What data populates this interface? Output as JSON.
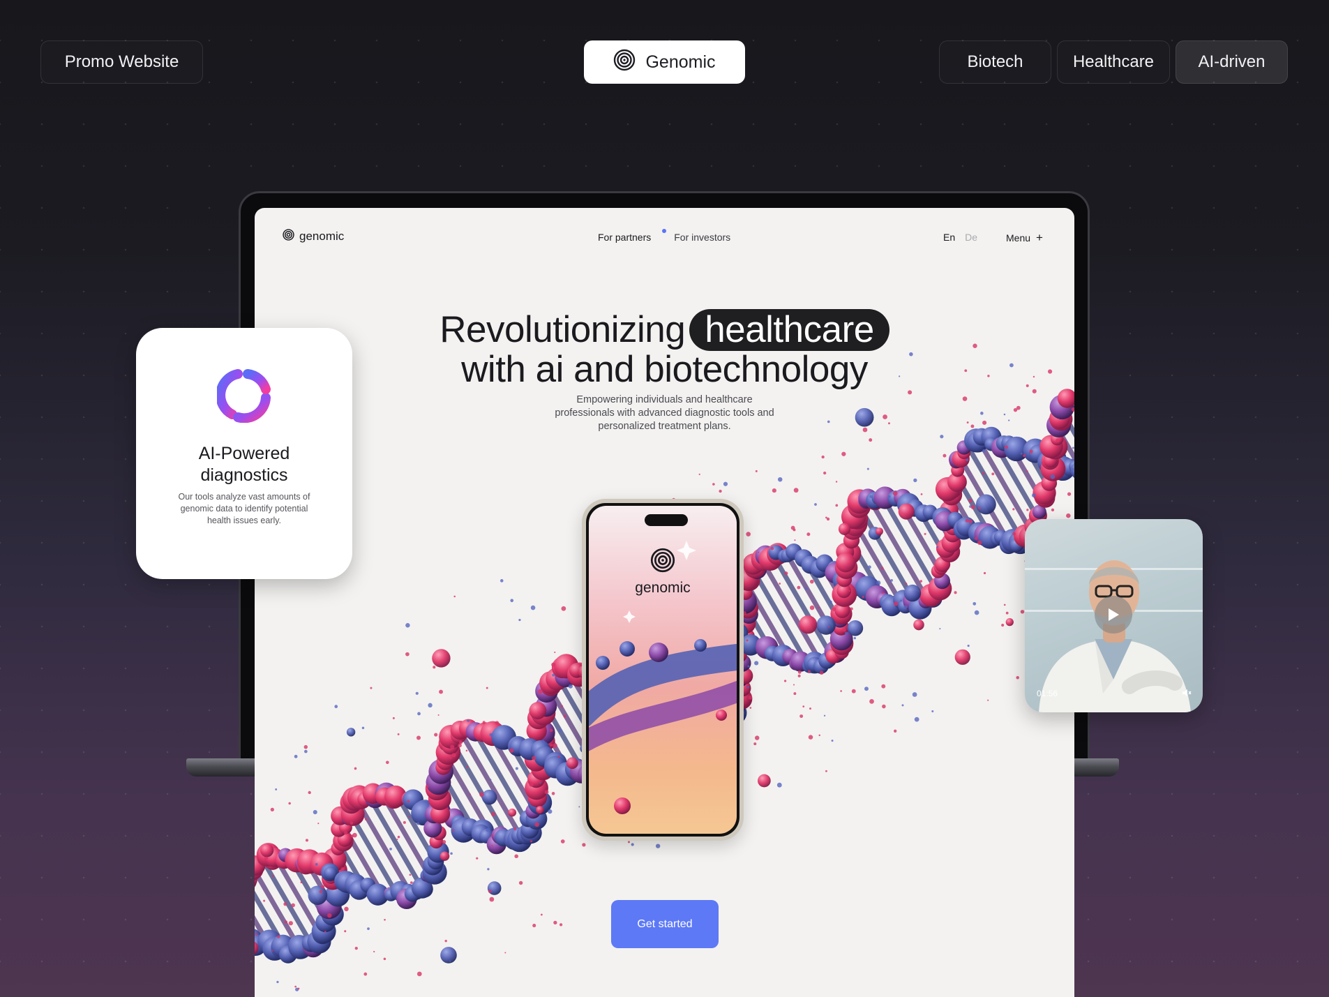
{
  "top_bar": {
    "category_label": "Promo Website",
    "brand_label": "Genomic",
    "tags": [
      "Biotech",
      "Healthcare",
      "AI-driven"
    ]
  },
  "site": {
    "logo_text": "genomic",
    "nav": [
      "For partners",
      "For investors"
    ],
    "lang_active": "En",
    "lang_inactive": "De",
    "menu_label": "Menu",
    "menu_icon": "+",
    "hero": {
      "title_part1": "Revolutionizing",
      "title_highlight": "healthcare",
      "title_line2": "with ai and biotechnology",
      "subtitle_lines": [
        "Empowering individuals and healthcare",
        "professionals with advanced diagnostic tools and",
        "personalized treatment plans."
      ]
    },
    "phone_logo_text": "genomic",
    "cta_label": "Get started"
  },
  "feature_card": {
    "title_lines": [
      "AI-Powered",
      "diagnostics"
    ],
    "description": "Our tools analyze vast amounts of genomic data to identify potential health issues early."
  },
  "video_card": {
    "duration": "01:56",
    "play_icon": "play-icon",
    "mute_icon": "mute-icon"
  },
  "colors": {
    "accent": "#5d79f6",
    "highlight_bg": "#1f1f22",
    "dna_pink": "#e8406f",
    "dna_blue": "#4f5fb0"
  }
}
